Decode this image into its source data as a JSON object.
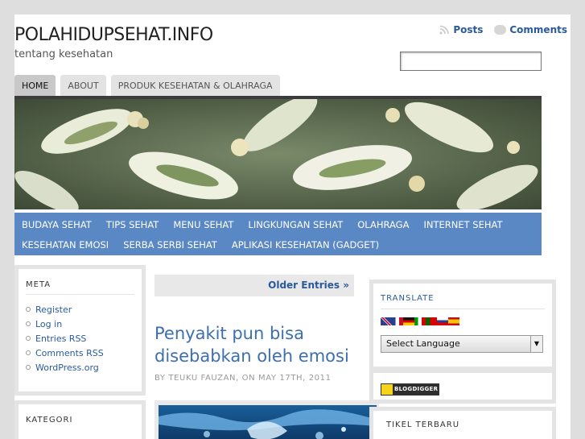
{
  "header": {
    "site_title": "POLAHIDUPSEHAT.INFO",
    "site_description": "tentang kesehatan",
    "posts_feed_label": "Posts",
    "comments_feed_label": "Comments",
    "search": {
      "value": "",
      "placeholder": ""
    }
  },
  "nav": {
    "tabs": [
      {
        "label": "HOME",
        "active": true
      },
      {
        "label": "ABOUT",
        "active": false
      },
      {
        "label": "PRODUK KESEHATAN & OLAHRAGA",
        "active": false
      }
    ]
  },
  "categories": {
    "row1": [
      "BUDAYA SEHAT",
      "TIPS SEHAT",
      "MENU SEHAT",
      "LINGKUNGAN SEHAT",
      "OLAHRAGA",
      "INTERNET SEHAT"
    ],
    "row2": [
      "KESEHATAN EMOSI",
      "SERBA SERBI SEHAT",
      "APLIKASI KESEHATAN (GADGET)"
    ]
  },
  "sidebar_left": {
    "meta_title": "META",
    "meta_items": [
      "Register",
      "Log in",
      "Entries RSS",
      "Comments RSS",
      "WordPress.org"
    ],
    "kategori_title": "KATEGORI"
  },
  "main": {
    "older_entries": "Older Entries »",
    "post_title": "Penyakit pun bisa disebabkan oleh emosi",
    "post_meta": "BY TEUKU FAUZAN, ON MAY 17TH, 2011"
  },
  "sidebar_right": {
    "translate_title": "TRANSLATE",
    "language_select": "Select Language",
    "blogdigger_badge": "BLOGDIGGER",
    "artikel_title": "TIKEL TERBARU"
  },
  "colors": {
    "accent": "#3d6fae",
    "link": "#2a5a9c",
    "category_bar": "#5a88c4",
    "page_background": "#dedede"
  }
}
